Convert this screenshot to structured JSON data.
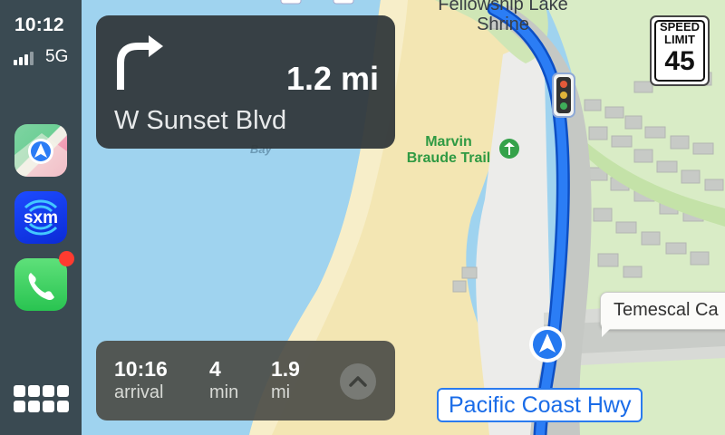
{
  "status": {
    "time": "10:12",
    "network": "5G",
    "signal_bars": 4,
    "signal_bars_full": 3
  },
  "sidebar": {
    "apps": [
      {
        "name": "Maps",
        "icon": "maps-icon"
      },
      {
        "name": "SiriusXM",
        "icon": "sxm-icon",
        "label": "sxm"
      },
      {
        "name": "Phone",
        "icon": "phone-icon",
        "has_notification_badge": true
      }
    ],
    "dashboard_icon": "app-grid-icon"
  },
  "maneuver": {
    "icon": "turn-right-icon",
    "distance": "1.2 mi",
    "street": "W Sunset Blvd"
  },
  "trip": {
    "arrival": {
      "value": "10:16",
      "label": "arrival"
    },
    "duration": {
      "value": "4",
      "label": "min"
    },
    "distance": {
      "value": "1.9",
      "label": "mi"
    },
    "expand_icon": "chevron-up-icon"
  },
  "speed_limit": {
    "line1": "SPEED",
    "line2": "LIMIT",
    "value": "45"
  },
  "map": {
    "place_shrine": "Fellowship Lake\nShrine",
    "place_trail": "Marvin\nBraude Trail",
    "water_label": "Bay",
    "callout": "Temescal Ca",
    "current_road": "Pacific Coast Hwy",
    "icons": [
      "traffic-light-icon",
      "trail-marker-icon",
      "position-arrow-icon"
    ],
    "colors": {
      "route": "#1f6ef0",
      "water": "#9fd3ef",
      "sand": "#f3e6b3",
      "land": "#d9ecc6"
    }
  }
}
